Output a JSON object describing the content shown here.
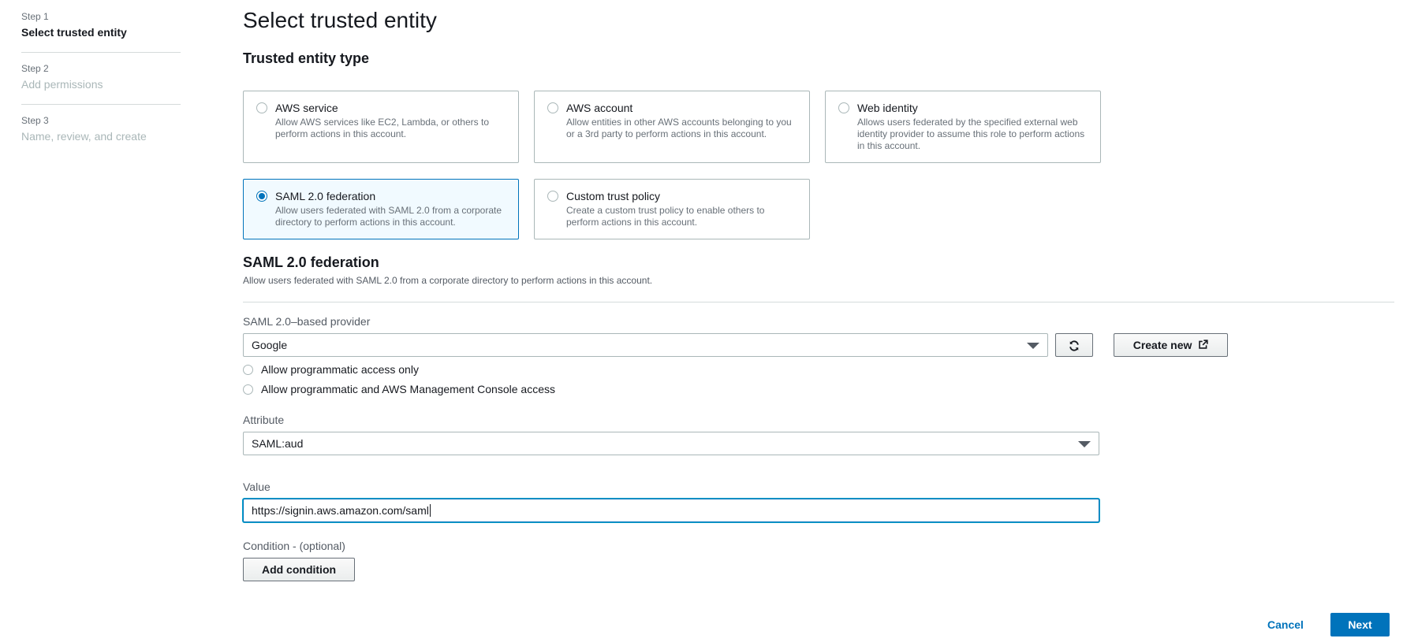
{
  "steps": [
    {
      "num": "Step 1",
      "title": "Select trusted entity"
    },
    {
      "num": "Step 2",
      "title": "Add permissions"
    },
    {
      "num": "Step 3",
      "title": "Name, review, and create"
    }
  ],
  "page_title": "Select trusted entity",
  "section_title": "Trusted entity type",
  "tiles": [
    {
      "title": "AWS service",
      "desc": "Allow AWS services like EC2, Lambda, or others to perform actions in this account.",
      "selected": false
    },
    {
      "title": "AWS account",
      "desc": "Allow entities in other AWS accounts belonging to you or a 3rd party to perform actions in this account.",
      "selected": false
    },
    {
      "title": "Web identity",
      "desc": "Allows users federated by the specified external web identity provider to assume this role to perform actions in this account.",
      "selected": false
    },
    {
      "title": "SAML 2.0 federation",
      "desc": "Allow users federated with SAML 2.0 from a corporate directory to perform actions in this account.",
      "selected": true
    },
    {
      "title": "Custom trust policy",
      "desc": "Create a custom trust policy to enable others to perform actions in this account.",
      "selected": false
    }
  ],
  "saml": {
    "title": "SAML 2.0 federation",
    "desc": "Allow users federated with SAML 2.0 from a corporate directory to perform actions in this account.",
    "provider_label": "SAML 2.0–based provider",
    "provider_value": "Google",
    "create_new_label": "Create new",
    "access_options": [
      {
        "label": "Allow programmatic access only",
        "checked": false
      },
      {
        "label": "Allow programmatic and AWS Management Console access",
        "checked": false
      }
    ],
    "attribute_label": "Attribute",
    "attribute_value": "SAML:aud",
    "value_label": "Value",
    "value_value": "https://signin.aws.amazon.com/saml",
    "condition_label": "Condition - (optional)",
    "add_condition_label": "Add condition"
  },
  "footer": {
    "cancel_label": "Cancel",
    "next_label": "Next"
  },
  "colors": {
    "accent": "#0073bb",
    "selected_tile_bg": "#f1faff",
    "border": "#aab7b8"
  },
  "icons": {
    "refresh": "refresh-icon",
    "external_link": "external-link-icon",
    "dropdown": "chevron-down-icon"
  }
}
